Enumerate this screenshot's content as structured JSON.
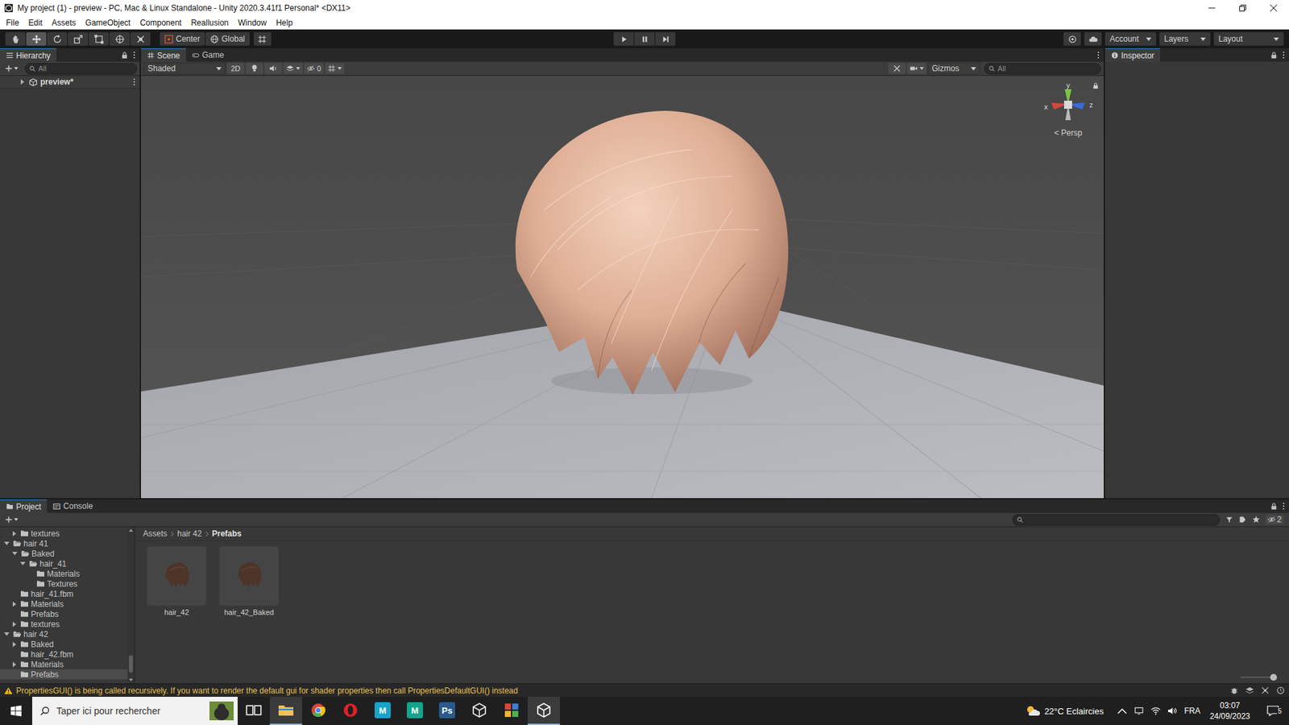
{
  "window": {
    "title": "My project (1) - preview - PC, Mac & Linux Standalone - Unity 2020.3.41f1 Personal* <DX11>"
  },
  "menu": [
    "File",
    "Edit",
    "Assets",
    "GameObject",
    "Component",
    "Reallusion",
    "Window",
    "Help"
  ],
  "toolbar": {
    "tools": [
      {
        "kind": "hand",
        "selected": false
      },
      {
        "kind": "move",
        "selected": true
      },
      {
        "kind": "rotate",
        "selected": false
      },
      {
        "kind": "scale",
        "selected": false
      },
      {
        "kind": "rect",
        "selected": false
      },
      {
        "kind": "transform",
        "selected": false
      },
      {
        "kind": "custom",
        "selected": false
      }
    ],
    "pivot": "Center",
    "space": "Global",
    "playing": false,
    "paused": false,
    "account": "Account",
    "layers": "Layers",
    "layout": "Layout"
  },
  "hierarchy": {
    "title": "Hierarchy",
    "search_placeholder": "All",
    "items": [
      {
        "label": "preview*",
        "expanded": false
      }
    ]
  },
  "scene": {
    "tabs": [
      {
        "label": "Scene",
        "selected": true
      },
      {
        "label": "Game",
        "selected": false
      }
    ],
    "shading": "Shaded",
    "mode_2d": "2D",
    "mode_2d_on": false,
    "hidden_count": "0",
    "gizmos": "Gizmos",
    "search_placeholder": "All",
    "axes": {
      "y": "y",
      "x": "x",
      "z": "z"
    },
    "projection": "< Persp"
  },
  "inspector": {
    "title": "Inspector"
  },
  "project": {
    "tabs": [
      {
        "label": "Project",
        "selected": true
      },
      {
        "label": "Console",
        "selected": false
      }
    ],
    "hidden_count": "2",
    "tree": [
      {
        "label": "textures",
        "depth": 1,
        "expandable": true,
        "expanded": false,
        "selected": false
      },
      {
        "label": "hair 41",
        "depth": 0,
        "expandable": true,
        "expanded": true,
        "selected": false
      },
      {
        "label": "Baked",
        "depth": 1,
        "expandable": true,
        "expanded": true,
        "selected": false
      },
      {
        "label": "hair_41",
        "depth": 2,
        "expandable": true,
        "expanded": true,
        "selected": false
      },
      {
        "label": "Materials",
        "depth": 3,
        "expandable": false,
        "expanded": false,
        "selected": false
      },
      {
        "label": "Textures",
        "depth": 3,
        "expandable": false,
        "expanded": false,
        "selected": false
      },
      {
        "label": "hair_41.fbm",
        "depth": 1,
        "expandable": false,
        "expanded": false,
        "selected": false
      },
      {
        "label": "Materials",
        "depth": 1,
        "expandable": true,
        "expanded": false,
        "selected": false
      },
      {
        "label": "Prefabs",
        "depth": 1,
        "expandable": false,
        "expanded": false,
        "selected": false
      },
      {
        "label": "textures",
        "depth": 1,
        "expandable": true,
        "expanded": false,
        "selected": false
      },
      {
        "label": "hair 42",
        "depth": 0,
        "expandable": true,
        "expanded": true,
        "selected": false
      },
      {
        "label": "Baked",
        "depth": 1,
        "expandable": true,
        "expanded": false,
        "selected": false
      },
      {
        "label": "hair_42.fbm",
        "depth": 1,
        "expandable": false,
        "expanded": false,
        "selected": false
      },
      {
        "label": "Materials",
        "depth": 1,
        "expandable": true,
        "expanded": false,
        "selected": false
      },
      {
        "label": "Prefabs",
        "depth": 1,
        "expandable": false,
        "expanded": false,
        "selected": true
      }
    ],
    "breadcrumb": [
      "Assets",
      "hair 42",
      "Prefabs"
    ],
    "assets": [
      {
        "label": "hair_42",
        "selected": false
      },
      {
        "label": "hair_42_Baked",
        "selected": false
      }
    ],
    "zoom_level": 1
  },
  "status_bar": {
    "message": "PropertiesGUI() is being called recursively. If you want to render the default gui for shader properties then call PropertiesDefaultGUI() instead"
  },
  "taskbar": {
    "search_placeholder": "Taper ici pour rechercher",
    "apps": [
      {
        "kind": "folder",
        "label": "",
        "color": "#f2c14e",
        "active": true
      },
      {
        "kind": "chrome",
        "label": "",
        "color": "#4caf50",
        "active": false
      },
      {
        "kind": "opera",
        "label": "",
        "color": "#e0202a",
        "active": false
      },
      {
        "kind": "letter",
        "label": "M",
        "color": "#1aa3c8",
        "active": false
      },
      {
        "kind": "letter",
        "label": "M",
        "color": "#14a38b",
        "active": false
      },
      {
        "kind": "letter",
        "label": "Ps",
        "color": "#2a5a8c",
        "active": false
      },
      {
        "kind": "unity",
        "label": "",
        "color": "#e8e8e8",
        "active": false
      },
      {
        "kind": "grid",
        "label": "",
        "color": "#d9453b",
        "active": false
      },
      {
        "kind": "unity",
        "label": "",
        "color": "#ffffff",
        "active": true
      }
    ],
    "weather": "22°C Eclaircies",
    "language": "FRA",
    "time": "03:07",
    "date": "24/09/2023",
    "notifications": "5"
  }
}
